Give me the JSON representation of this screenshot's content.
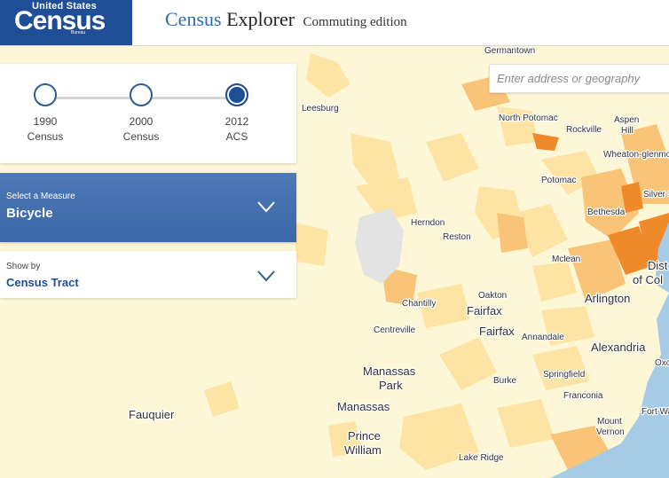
{
  "header": {
    "logo": {
      "line1": "United States",
      "line2": "Census",
      "line3": "Bureau"
    },
    "title_part1": "Census",
    "title_part2": " Explorer",
    "subtitle": "Commuting edition"
  },
  "search": {
    "placeholder": "Enter address or geography"
  },
  "timeline": {
    "items": [
      {
        "year": "1990",
        "label": "Census",
        "active": false
      },
      {
        "year": "2000",
        "label": "Census",
        "active": false
      },
      {
        "year": "2012",
        "label": "ACS",
        "active": true
      }
    ]
  },
  "measure": {
    "caption": "Select a Measure",
    "value": "Bicycle"
  },
  "showby": {
    "caption": "Show by",
    "value": "Census Tract"
  },
  "map": {
    "places": [
      "Germantown",
      "Leesburg",
      "North Potomac",
      "Rockville",
      "Aspen",
      "Hill",
      "Wheaton-glenmo",
      "Potomac",
      "Silver S",
      "Bethesda",
      "Herndon",
      "Reston",
      "Dist",
      "of Col",
      "Mclean",
      "Chantilly",
      "Oakton",
      "Fairfax",
      "Arlington",
      "Centreville",
      "Fairfax",
      "Annandale",
      "Alexandria",
      "Oxo",
      "Manassas",
      "Park",
      "Springfield",
      "Burke",
      "Franconia",
      "Fauquier",
      "Manassas",
      "Fort Wa",
      "Mount",
      "Vernon",
      "Prince",
      "William",
      "Lake Ridge"
    ]
  },
  "colors": {
    "brand": "#1f4e96",
    "map_base": "#fdf7d8",
    "tract_light": "#fde6a6",
    "tract_mid": "#f9c97a",
    "tract_dark": "#ef8a2a",
    "water": "#a6cbe6"
  }
}
